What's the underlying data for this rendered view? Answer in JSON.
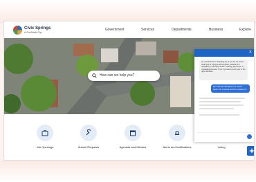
{
  "header": {
    "logo_name": "Civic Springs",
    "logo_tag": "A GovStack City",
    "nav": [
      "Government",
      "Services",
      "Departments",
      "Business",
      "Explore"
    ]
  },
  "search": {
    "placeholder": "How can we help you?"
  },
  "quick_links": [
    {
      "label": "Job Openings",
      "icon": "briefcase-icon"
    },
    {
      "label": "Submit Requests",
      "icon": "wrench-icon"
    },
    {
      "label": "Agendas and Minutes",
      "icon": "calendar-icon"
    },
    {
      "label": "Alerts and Notifications",
      "icon": "bell-icon"
    },
    {
      "label": "Voting",
      "icon": "ballot-icon"
    }
  ],
  "chat": {
    "bot_message": "Hi, and thanks for stopping by. If you let me know what you're trying to accomplish, whether it's navigating municipal codes, making payments, or managing permits, I'll do my best to point you in the right direction.",
    "user_message": "My mail was damaged in a recent storm. Do I need a permit to replace it?"
  },
  "colors": {
    "accent": "#1f65c6",
    "quick_bg": "#e3ecf7"
  }
}
